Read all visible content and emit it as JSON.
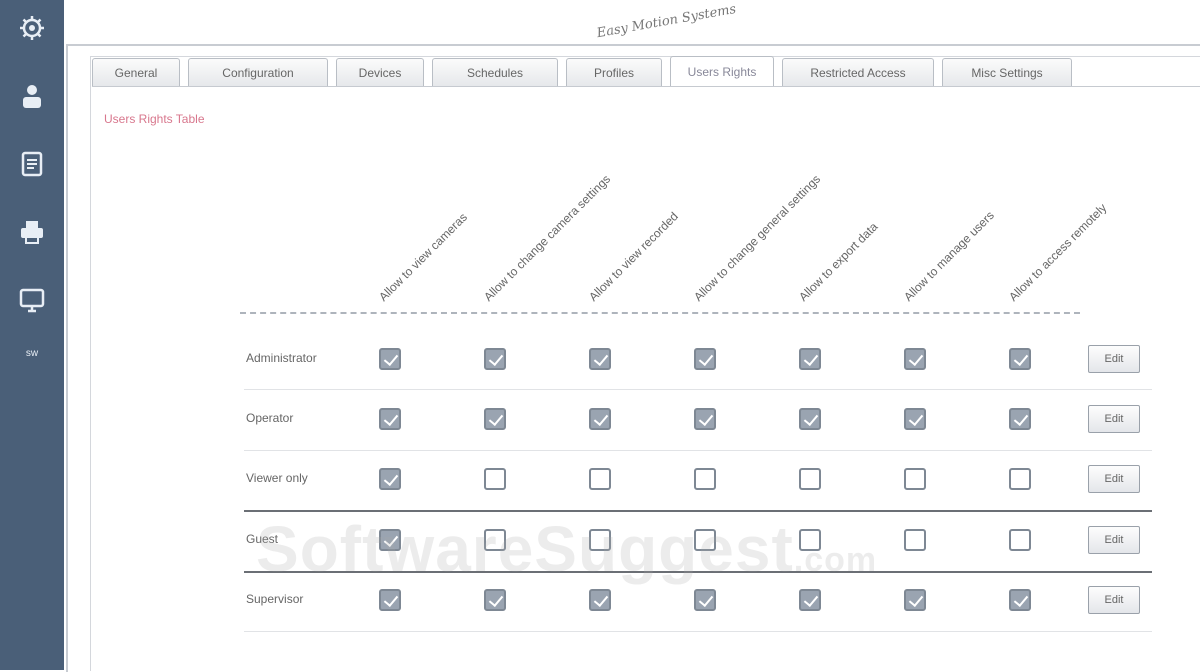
{
  "rail": {
    "items": [
      {
        "icon": "settings-icon"
      },
      {
        "icon": "user-icon"
      },
      {
        "icon": "document-icon"
      },
      {
        "icon": "printer-icon"
      },
      {
        "icon": "monitor-icon"
      }
    ],
    "label": "sw"
  },
  "header": {
    "logo_text": "Easy Motion Systems"
  },
  "tabs": [
    {
      "label": "General"
    },
    {
      "label": "Configuration"
    },
    {
      "label": "Devices"
    },
    {
      "label": "Schedules"
    },
    {
      "label": "Profiles"
    },
    {
      "label": "Users Rights",
      "active": true
    },
    {
      "label": "Restricted Access"
    },
    {
      "label": "Misc Settings"
    }
  ],
  "section_title": "Users Rights Table",
  "columns": [
    {
      "label": "Allow to view cameras"
    },
    {
      "label": "Allow to change camera settings"
    },
    {
      "label": "Allow to view recorded"
    },
    {
      "label": "Allow to change general settings"
    },
    {
      "label": "Allow to export data"
    },
    {
      "label": "Allow to manage users"
    },
    {
      "label": "Allow to access remotely"
    }
  ],
  "rows": [
    {
      "label": "Administrator",
      "checks": [
        true,
        true,
        true,
        true,
        true,
        true,
        true
      ],
      "button": "Edit"
    },
    {
      "label": "Operator",
      "checks": [
        true,
        true,
        true,
        true,
        true,
        true,
        true
      ],
      "button": "Edit"
    },
    {
      "label": "Viewer only",
      "checks": [
        true,
        false,
        false,
        false,
        false,
        false,
        false
      ],
      "button": "Edit"
    },
    {
      "label": "Guest",
      "checks": [
        true,
        false,
        false,
        false,
        false,
        false,
        false
      ],
      "button": "Edit"
    },
    {
      "label": "Supervisor",
      "checks": [
        true,
        true,
        true,
        true,
        true,
        true,
        true
      ],
      "button": "Edit"
    }
  ],
  "watermark": {
    "main": "SoftwareSuggest",
    "suffix": ".com"
  }
}
